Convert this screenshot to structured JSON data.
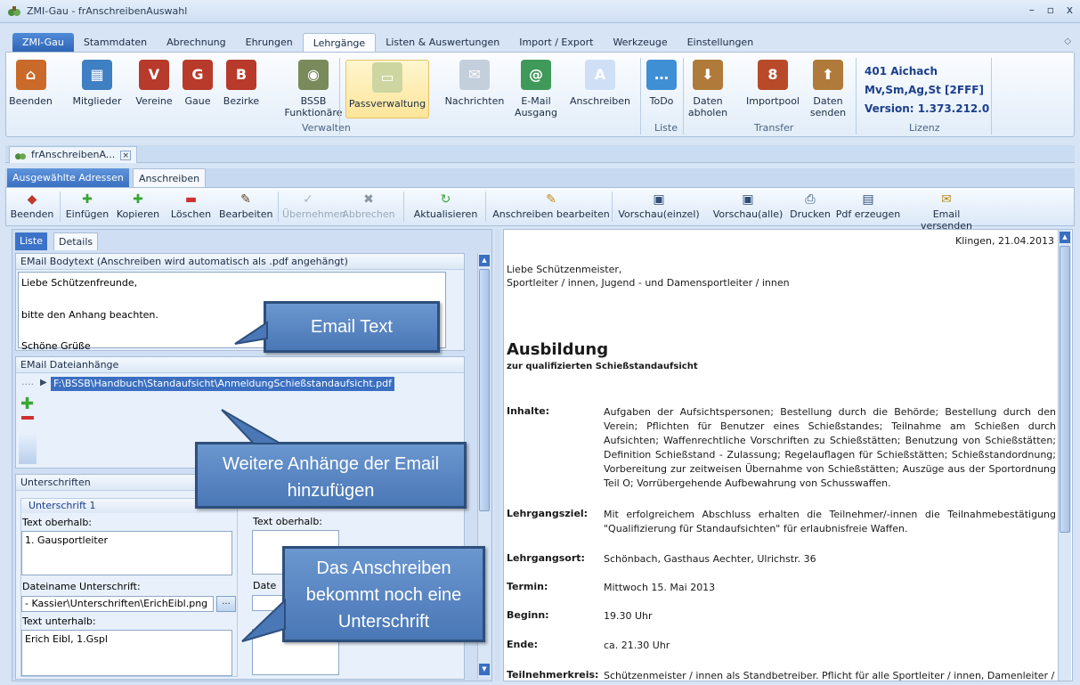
{
  "window": {
    "title": "ZMI-Gau - frAnschreibenAuswahl",
    "controls": [
      "–",
      "▫",
      "x"
    ]
  },
  "menu_tabs": [
    {
      "label": "ZMI-Gau",
      "kind": "file"
    },
    {
      "label": "Stammdaten",
      "kind": ""
    },
    {
      "label": "Abrechnung",
      "kind": ""
    },
    {
      "label": "Ehrungen",
      "kind": ""
    },
    {
      "label": "Lehrgänge",
      "kind": "active"
    },
    {
      "label": "Listen & Auswertungen",
      "kind": ""
    },
    {
      "label": "Import / Export",
      "kind": ""
    },
    {
      "label": "Werkzeuge",
      "kind": ""
    },
    {
      "label": "Einstellungen",
      "kind": ""
    }
  ],
  "ribbon": {
    "buttons": [
      {
        "label": "Beenden",
        "icon": "house-icon"
      },
      {
        "label": "Mitglieder",
        "icon": "members-icon"
      },
      {
        "label": "Vereine",
        "icon": "house-v-icon"
      },
      {
        "label": "Gaue",
        "icon": "house-g-icon"
      },
      {
        "label": "Bezirke",
        "icon": "house-b-icon"
      },
      {
        "label": "BSSB Funktionäre",
        "icon": "officials-icon"
      },
      {
        "label": "Passverwaltung",
        "icon": "id-card-icon"
      },
      {
        "label": "Nachrichten",
        "icon": "envelope-icon"
      },
      {
        "label": "E-Mail Ausgang",
        "icon": "email-outbox-icon"
      },
      {
        "label": "Anschreiben",
        "icon": "letter-icon"
      },
      {
        "label": "ToDo",
        "icon": "speech-bubble-icon"
      },
      {
        "label": "Daten abholen",
        "icon": "box-download-icon"
      },
      {
        "label": "Importpool",
        "icon": "importpool-icon"
      },
      {
        "label": "Daten senden",
        "icon": "box-upload-icon"
      }
    ],
    "groups": [
      "Verwalten",
      "Liste",
      "Transfer",
      "Lizenz"
    ],
    "license": {
      "line1": "401 Aichach",
      "line2": "Mv,Sm,Ag,St [2FFF]",
      "line3": "Version: 1.373.212.0"
    }
  },
  "doc_tab": {
    "label": "frAnschreibenA...",
    "close": "×"
  },
  "sub_tabs": [
    "Ausgewählte Adressen",
    "Anschreiben"
  ],
  "toolbar": [
    {
      "label": "Beenden",
      "icon": "exit-icon",
      "glyph": "◆",
      "color": "#c0392b"
    },
    {
      "label": "Einfügen",
      "icon": "plus-icon",
      "glyph": "✚",
      "color": "#3aa535"
    },
    {
      "label": "Kopieren",
      "icon": "copy-plus-icon",
      "glyph": "✚",
      "color": "#3aa535"
    },
    {
      "label": "Löschen",
      "icon": "minus-icon",
      "glyph": "▬",
      "color": "#d03030"
    },
    {
      "label": "Bearbeiten",
      "icon": "pencil-icon",
      "glyph": "✎",
      "color": "#5a4a2a"
    },
    {
      "label": "Übernehmen",
      "icon": "check-icon",
      "glyph": "✓",
      "color": "#a9b4c2"
    },
    {
      "label": "Abbrechen",
      "icon": "cancel-icon",
      "glyph": "✖",
      "color": "#8b95a3"
    },
    {
      "label": "Aktualisieren",
      "icon": "refresh-icon",
      "glyph": "↻",
      "color": "#3aa535"
    },
    {
      "label": "Anschreiben bearbeiten",
      "icon": "pencil-icon",
      "glyph": "✎",
      "color": "#c28a1a"
    },
    {
      "label": "Vorschau(einzel)",
      "icon": "monitor-icon",
      "glyph": "▣",
      "color": "#2f4f7a"
    },
    {
      "label": "Vorschau(alle)",
      "icon": "monitor-icon",
      "glyph": "▣",
      "color": "#2f4f7a"
    },
    {
      "label": "Drucken",
      "icon": "printer-icon",
      "glyph": "⎙",
      "color": "#2f4f7a"
    },
    {
      "label": "Pdf erzeugen",
      "icon": "pdf-icon",
      "glyph": "▤",
      "color": "#2f4f7a"
    },
    {
      "label": "Email versenden",
      "icon": "email-send-icon",
      "glyph": "✉",
      "color": "#b58a1a"
    }
  ],
  "left": {
    "tabs": [
      "Liste",
      "Details"
    ],
    "email_body": {
      "header": "EMail Bodytext (Anschreiben wird automatisch als .pdf angehängt)",
      "lines": [
        "Liebe Schützenfreunde,",
        "bitte den Anhang beachten.",
        "Schöne Grüße"
      ]
    },
    "attachments": {
      "header": "EMail Dateianhänge",
      "items": [
        "F:\\BSSB\\Handbuch\\Standaufsicht\\AnmeldungSchießstandaufsicht.pdf"
      ]
    },
    "signatures": {
      "header": "Unterschriften",
      "sig1": {
        "header": "Unterschrift 1",
        "text_above_label": "Text oberhalb:",
        "text_above": "1. Gausportleiter",
        "filename_label": "Dateiname Unterschrift:",
        "filename": "- Kassier\\Unterschriften\\ErichEibl.png",
        "browse": "...",
        "text_below_label": "Text unterhalb:",
        "text_below": "Erich Eibl, 1.Gspl"
      },
      "sig2": {
        "text_above_label": "Text oberhalb:",
        "filename_label": "Date"
      }
    }
  },
  "letter": {
    "place_date": "Klingen, 21.04.2013",
    "salutation1": "Liebe Schützenmeister,",
    "salutation2": "Sportleiter / innen, Jugend - und Damensportleiter / innen",
    "heading": "Ausbildung",
    "subheading": "zur qualifizierten Schießstandaufsicht",
    "rows": [
      {
        "k": "Inhalte:",
        "v": "Aufgaben der Aufsichtspersonen; Bestellung durch die Behörde; Bestellung durch den Verein; Pflichten für Benutzer eines Schießstandes; Teilnahme am Schießen durch Aufsichten; Waffenrechtliche Vorschriften zu Schießstätten; Benutzung von Schießstätten; Definition Schießstand - Zulassung; Regelauflagen für Schießstätten; Schießstandordnung; Vorbereitung zur zeitweisen Übernahme von Schießstätten; Auszüge aus der Sportordnung Teil O; Vorrübergehende Aufbewahrung von Schusswaffen."
      },
      {
        "k": "Lehrgangsziel:",
        "v": "Mit erfolgreichem Abschluss erhalten die Teilnehmer/-innen die Teilnahmebestätigung \"Qualifizierung für Standaufsichten\" für erlaubnisfreie Waffen."
      },
      {
        "k": "Lehrgangsort:",
        "v": "Schönbach, Gasthaus Aechter, Ulrichstr. 36"
      },
      {
        "k": "Termin:",
        "v": "Mittwoch 15. Mai 2013"
      },
      {
        "k": "Beginn:",
        "v": "19.30 Uhr"
      },
      {
        "k": "Ende:",
        "v": "ca. 21.30 Uhr"
      },
      {
        "k": "Teilnehmerkreis:",
        "v": "Schützenmeister / innen als Standbetreiber. Pflicht für alle Sportleiter / innen, Damenleiter /"
      }
    ]
  },
  "callouts": {
    "email_text": "Email Text",
    "attachments": "Weitere Anhänge der Email hinzufügen",
    "signature": "Das Anschreiben bekommt noch eine Unterschrift"
  }
}
